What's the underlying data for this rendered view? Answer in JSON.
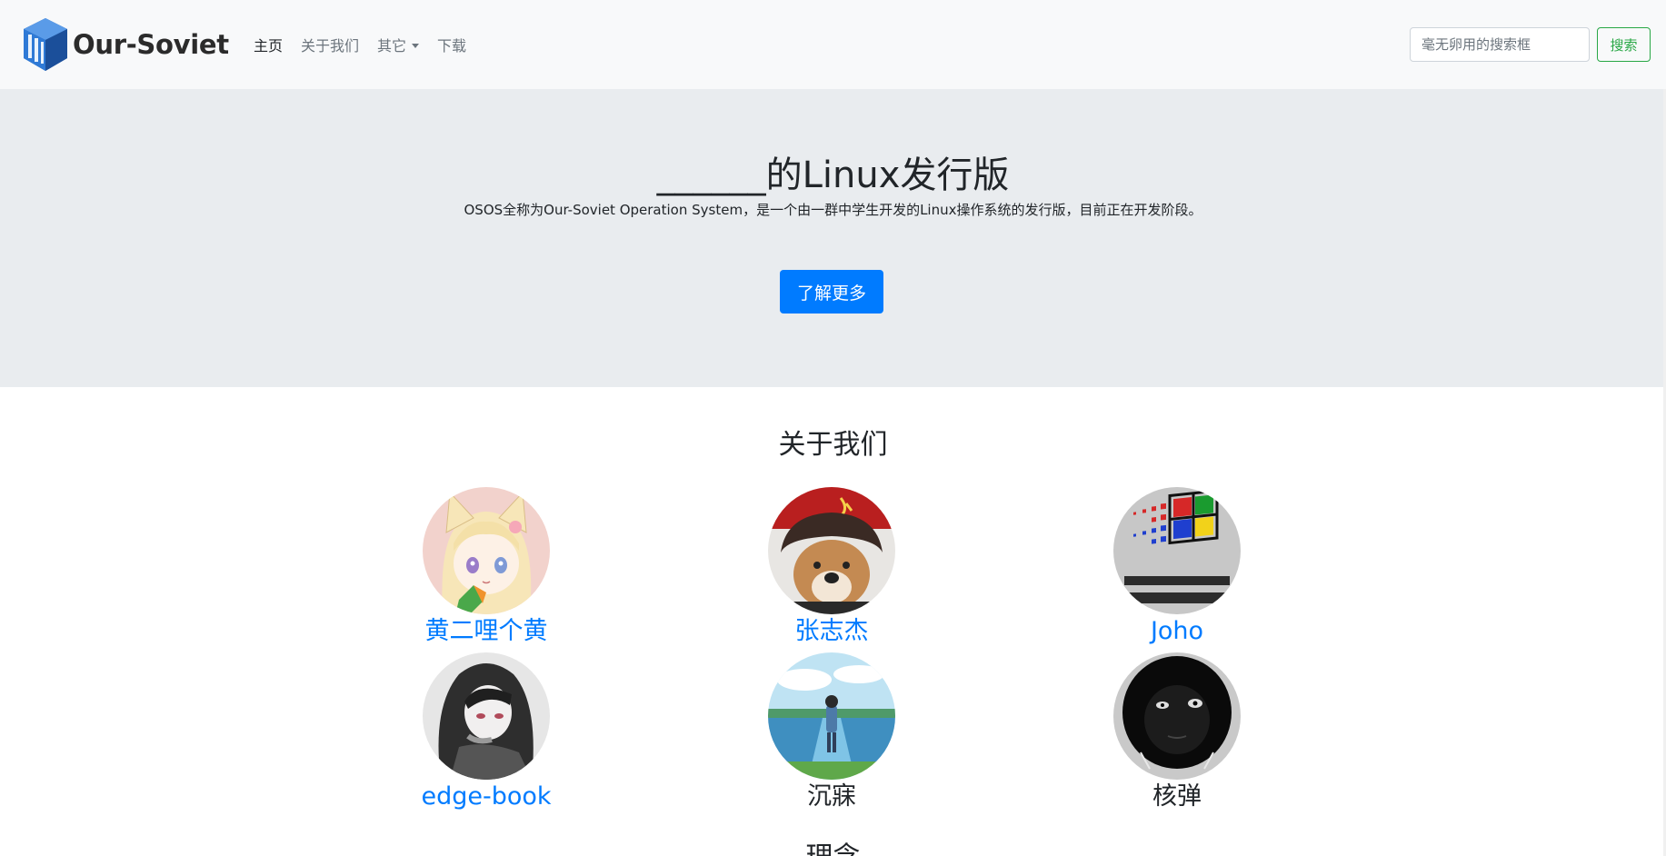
{
  "navbar": {
    "brand": "Our-Soviet",
    "links": [
      {
        "label": "主页",
        "active": true
      },
      {
        "label": "关于我们",
        "active": false
      },
      {
        "label": "其它",
        "active": false,
        "dropdown": true
      },
      {
        "label": "下载",
        "active": false
      }
    ],
    "search_placeholder": "毫无卵用的搜索框",
    "search_button": "搜索",
    "search_button_color": "#28a745"
  },
  "jumbotron": {
    "title": "______的Linux发行版",
    "description": "OSOS全称为Our-Soviet Operation System，是一个由一群中学生开发的Linux操作系统的发行版，目前正在开发阶段。",
    "button": "了解更多",
    "button_color": "#007bff"
  },
  "about": {
    "title": "关于我们",
    "members": [
      {
        "name": "黄二哩个黄",
        "link": true,
        "avatar": "anime-girl-avatar"
      },
      {
        "name": "张志杰",
        "link": true,
        "avatar": "dog-hat-avatar"
      },
      {
        "name": "Joho",
        "link": true,
        "avatar": "windows-nt-avatar"
      },
      {
        "name": "edge-book",
        "link": true,
        "avatar": "anime-sketch-avatar"
      },
      {
        "name": "沉寐",
        "link": false,
        "avatar": "lake-boy-avatar"
      },
      {
        "name": "核弹",
        "link": false,
        "avatar": "dark-face-avatar"
      }
    ]
  },
  "next_section": {
    "title": "理念"
  },
  "colors": {
    "link": "#007bff",
    "navbar_bg": "#f8f9fa",
    "jumbotron_bg": "#e9ecef"
  }
}
